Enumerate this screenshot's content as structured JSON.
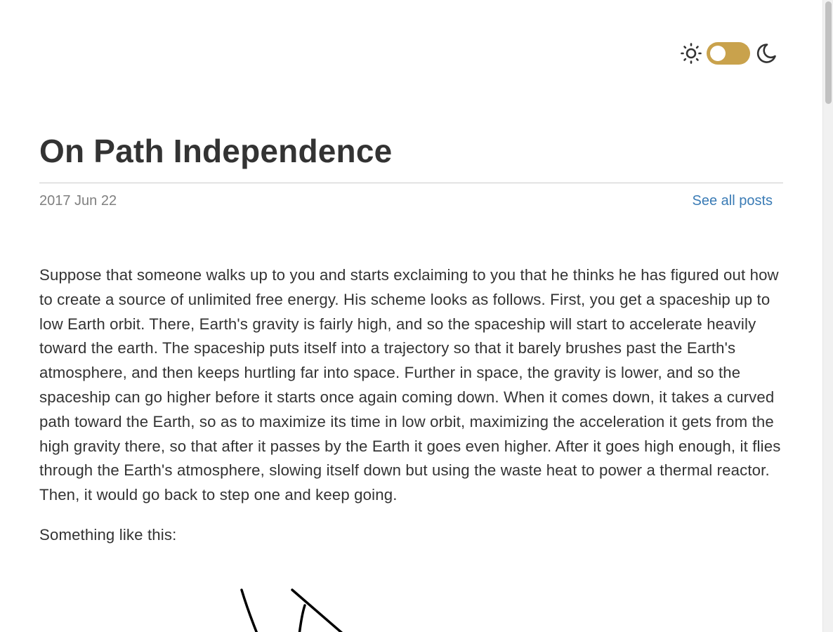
{
  "theme_toggle": {
    "sun_icon": "sun-icon",
    "moon_icon": "moon-icon",
    "accent_color": "#c9a24c",
    "state": "light"
  },
  "post": {
    "title": "On Path Independence",
    "date": "2017 Jun 22",
    "see_all_label": "See all posts",
    "paragraphs": [
      "Suppose that someone walks up to you and starts exclaiming to you that he thinks he has figured out how to create a source of unlimited free energy. His scheme looks as follows. First, you get a spaceship up to low Earth orbit. There, Earth's gravity is fairly high, and so the spaceship will start to accelerate heavily toward the earth. The spaceship puts itself into a trajectory so that it barely brushes past the Earth's atmosphere, and then keeps hurtling far into space. Further in space, the gravity is lower, and so the spaceship can go higher before it starts once again coming down. When it comes down, it takes a curved path toward the Earth, so as to maximize its time in low orbit, maximizing the acceleration it gets from the high gravity there, so that after it passes by the Earth it goes even higher. After it goes high enough, it flies through the Earth's atmosphere, slowing itself down but using the waste heat to power a thermal reactor. Then, it would go back to step one and keep going.",
      "Something like this:"
    ]
  },
  "colors": {
    "text": "#333333",
    "muted": "#808080",
    "link": "#3a7bb5",
    "rule": "#cccccc"
  }
}
